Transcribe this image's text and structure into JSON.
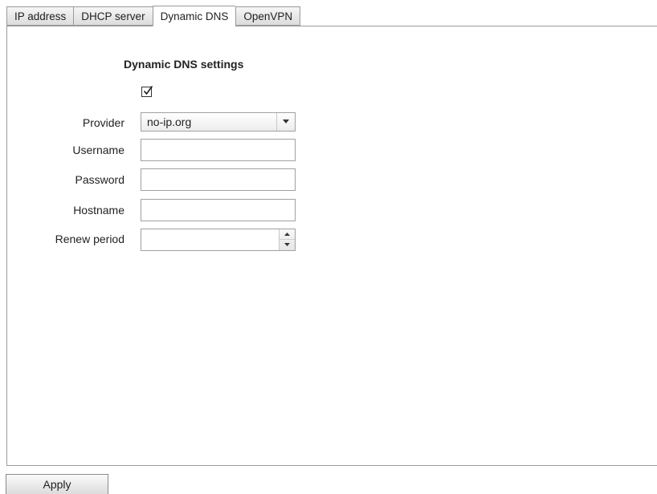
{
  "tabs": [
    {
      "label": "IP address",
      "active": false
    },
    {
      "label": "DHCP server",
      "active": false
    },
    {
      "label": "Dynamic DNS",
      "active": true
    },
    {
      "label": "OpenVPN",
      "active": false
    }
  ],
  "section": {
    "title": "Dynamic DNS settings",
    "enabled_checked": true
  },
  "form": {
    "provider": {
      "label": "Provider",
      "value": "no-ip.org"
    },
    "username": {
      "label": "Username",
      "value": ""
    },
    "password": {
      "label": "Password",
      "value": ""
    },
    "hostname": {
      "label": "Hostname",
      "value": ""
    },
    "renew_period": {
      "label": "Renew period",
      "value": ""
    }
  },
  "footer": {
    "apply_label": "Apply"
  },
  "icons": {
    "checkbox": "checkmark-icon",
    "select_arrow": "caret-down-icon",
    "spin_up": "caret-up-icon",
    "spin_down": "caret-down-icon"
  },
  "colors": {
    "border": "#9a9a9a",
    "text": "#222222",
    "background": "#ffffff"
  }
}
